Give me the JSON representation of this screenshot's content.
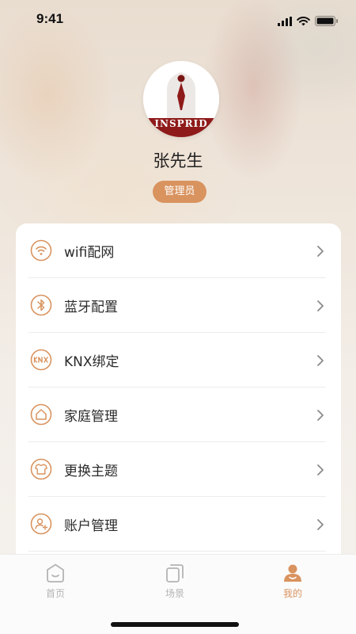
{
  "status_bar": {
    "time": "9:41",
    "icons": [
      "cellular-signal-icon",
      "wifi-icon",
      "battery-icon"
    ]
  },
  "profile": {
    "avatar_logo_text": "INSPRID",
    "name": "张先生",
    "role": "管理员"
  },
  "menu": {
    "items": [
      {
        "label": "wifi配网",
        "icon": "wifi-icon"
      },
      {
        "label": "蓝牙配置",
        "icon": "bluetooth-icon"
      },
      {
        "label": "KNX绑定",
        "icon": "knx-icon"
      },
      {
        "label": "家庭管理",
        "icon": "home-icon"
      },
      {
        "label": "更换主题",
        "icon": "shirt-icon"
      },
      {
        "label": "账户管理",
        "icon": "add-user-icon"
      }
    ]
  },
  "tab_bar": {
    "tabs": [
      {
        "label": "首页",
        "icon": "home-tab-icon",
        "active": false
      },
      {
        "label": "场景",
        "icon": "scene-tab-icon",
        "active": false
      },
      {
        "label": "我的",
        "icon": "profile-tab-icon",
        "active": true
      }
    ]
  },
  "colors": {
    "accent": "#d9935f",
    "inactive": "#b4b4b4",
    "text": "#2b2b2b"
  }
}
